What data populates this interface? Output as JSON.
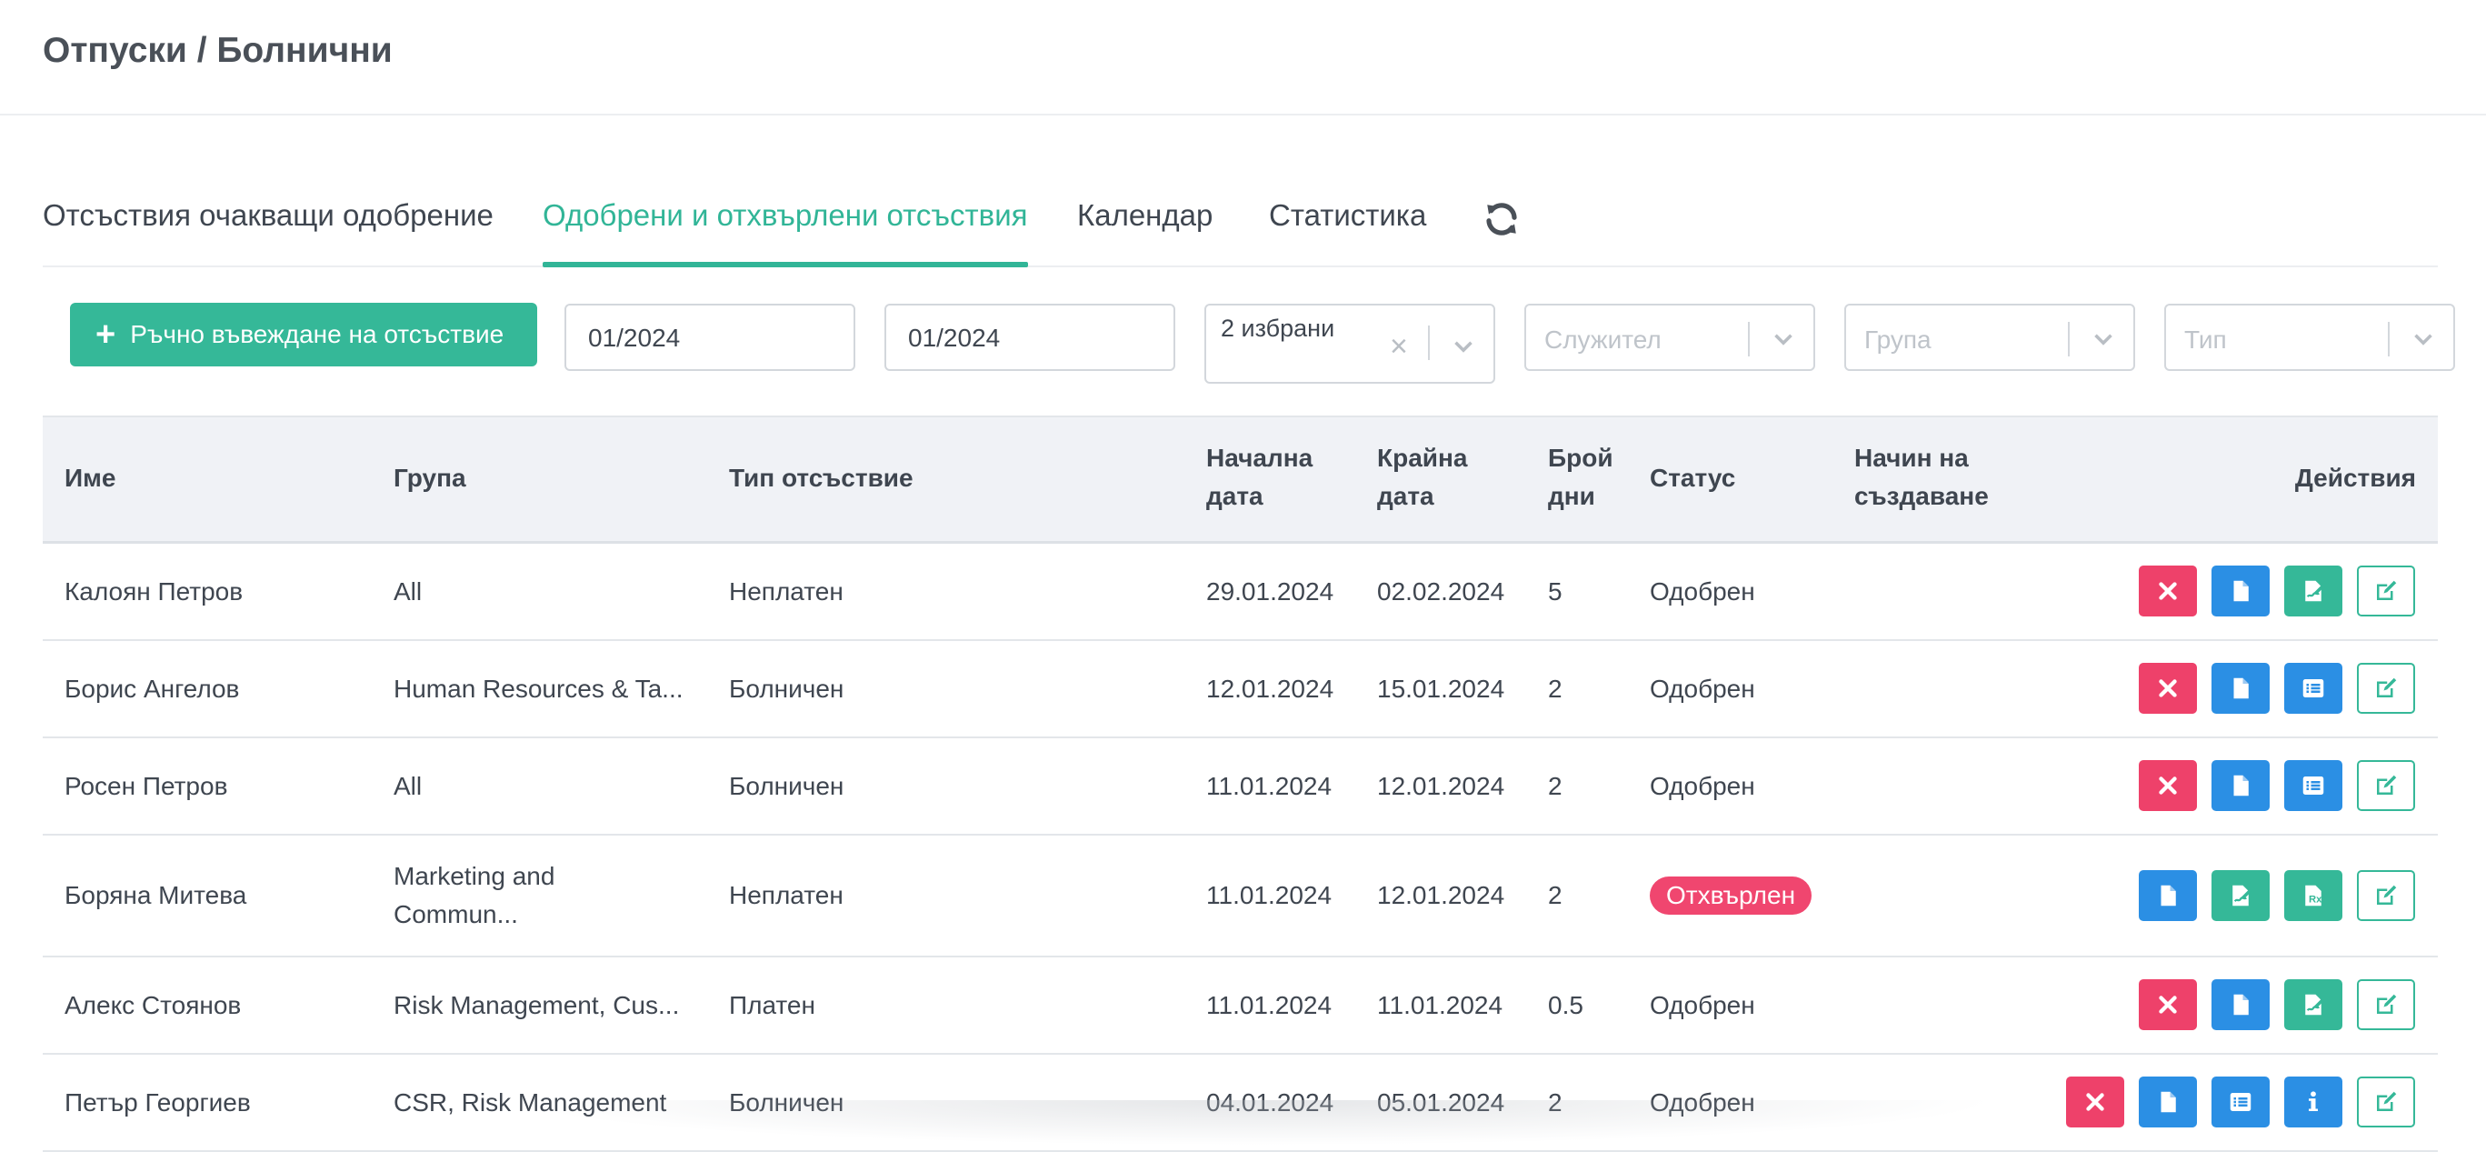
{
  "page": {
    "title": "Отпуски / Болнични"
  },
  "tabs": [
    {
      "label": "Отсъствия очакващи одобрение"
    },
    {
      "label": "Одобрени и отхвърлени отсъствия"
    },
    {
      "label": "Календар"
    },
    {
      "label": "Статистика"
    }
  ],
  "toolbar": {
    "add_label": "Ръчно въвеждане на отсъствие",
    "date_from": "01/2024",
    "date_to": "01/2024",
    "status_selected": "2 избрани",
    "employee_placeholder": "Служител",
    "group_placeholder": "Група",
    "type_placeholder": "Тип"
  },
  "table": {
    "headers": {
      "name": "Име",
      "group": "Група",
      "type": "Тип отсъствие",
      "start_l1": "Начална",
      "start_l2": "дата",
      "end_l1": "Крайна",
      "end_l2": "дата",
      "days_l1": "Брой",
      "days_l2": "дни",
      "status": "Статус",
      "method_l1": "Начин на",
      "method_l2": "създаване",
      "actions": "Действия"
    },
    "rows": [
      {
        "name": "Калоян Петров",
        "group": "All",
        "type": "Неплатен",
        "start": "29.01.2024",
        "end": "02.02.2024",
        "days": "5",
        "status": "Одобрен"
      },
      {
        "name": "Борис Ангелов",
        "group": "Human Resources & Ta...",
        "type": "Болничен",
        "start": "12.01.2024",
        "end": "15.01.2024",
        "days": "2",
        "status": "Одобрен"
      },
      {
        "name": "Росен Петров",
        "group": "All",
        "type": "Болничен",
        "start": "11.01.2024",
        "end": "12.01.2024",
        "days": "2",
        "status": "Одобрен"
      },
      {
        "name": "Боряна Митева",
        "group": "Marketing and Commun...",
        "type": "Неплатен",
        "start": "11.01.2024",
        "end": "12.01.2024",
        "days": "2",
        "status": "Отхвърлен"
      },
      {
        "name": "Алекс Стоянов",
        "group": "Risk Management, Cus...",
        "type": "Платен",
        "start": "11.01.2024",
        "end": "11.01.2024",
        "days": "0.5",
        "status": "Одобрен"
      },
      {
        "name": "Петър Георгиев",
        "group": "CSR, Risk Management",
        "type": "Болничен",
        "start": "04.01.2024",
        "end": "05.01.2024",
        "days": "2",
        "status": "Одобрен"
      }
    ]
  },
  "colors": {
    "accent": "#31b597",
    "danger": "#ee416a",
    "info": "#2b8fe4",
    "header_bg": "#f0f2f6"
  },
  "icons": [
    "refresh-icon",
    "plus-icon",
    "close-icon",
    "chevron-down-icon",
    "document-icon",
    "signature-icon",
    "list-icon",
    "info-icon",
    "edit-icon",
    "prescription-icon"
  ]
}
